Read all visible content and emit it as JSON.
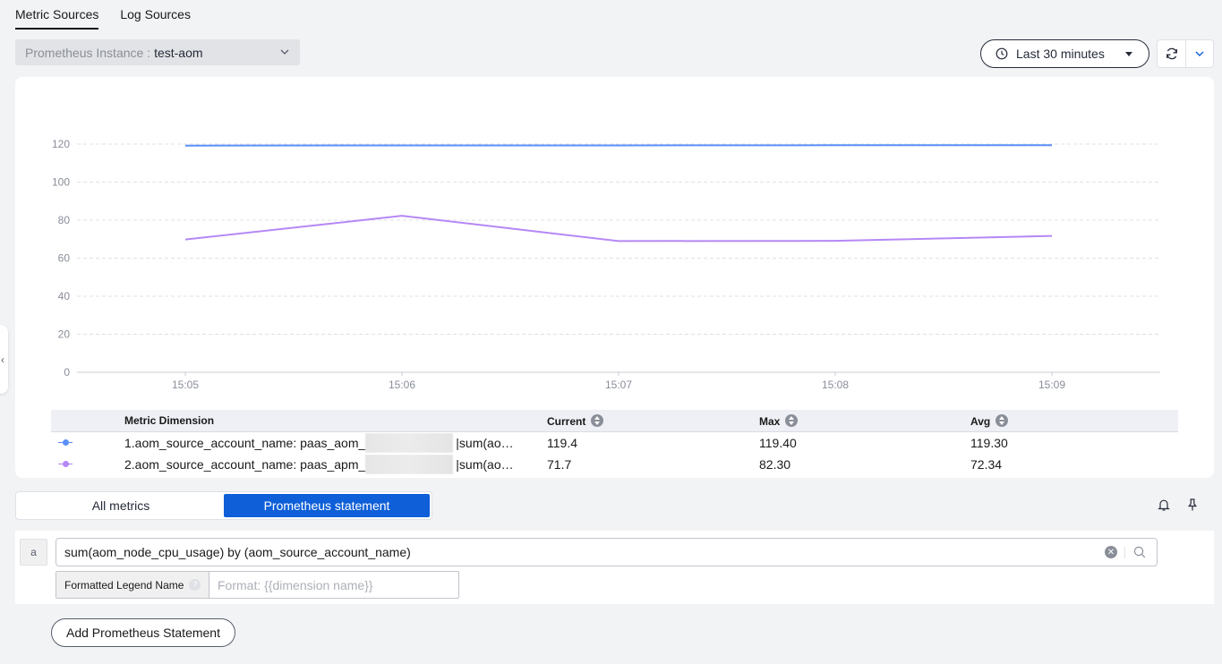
{
  "tabs": [
    {
      "label": "Metric Sources",
      "active": true
    },
    {
      "label": "Log Sources",
      "active": false
    }
  ],
  "instance": {
    "label": "Prometheus Instance :",
    "value": "test-aom"
  },
  "time_range": {
    "label": "Last 30 minutes"
  },
  "chart_data": {
    "type": "line",
    "x": [
      "15:05",
      "15:06",
      "15:07",
      "15:08",
      "15:09"
    ],
    "ylim": [
      0,
      120
    ],
    "yticks": [
      0,
      20,
      40,
      60,
      80,
      100,
      120
    ],
    "grid": true,
    "series": [
      {
        "color": "#5b8ff9",
        "values": [
          119.2,
          119.3,
          119.3,
          119.4,
          119.4
        ]
      },
      {
        "color": "#b588f5",
        "values": [
          69.8,
          82.3,
          69.0,
          69.1,
          71.7
        ]
      }
    ]
  },
  "legend_table": {
    "headers": {
      "dimension": "Metric Dimension",
      "current": "Current",
      "max": "Max",
      "avg": "Avg"
    },
    "rows": [
      {
        "prefix": "1.aom_source_account_name: paas_aom_",
        "suffix": "|sum(aom_node_cpu_usage)",
        "current": "119.4",
        "max": "119.40",
        "avg": "119.30",
        "color": "#5b8ff9"
      },
      {
        "prefix": "2.aom_source_account_name: paas_apm_",
        "suffix": "|sum(aom_node_cpu_usage)",
        "current": "71.7",
        "max": "82.30",
        "avg": "72.34",
        "color": "#b588f5"
      }
    ]
  },
  "mode": {
    "all_metrics": "All metrics",
    "prometheus_statement": "Prometheus statement"
  },
  "query": {
    "label": "a",
    "value": "sum(aom_node_cpu_usage) by (aom_source_account_name)",
    "legend_label": "Formatted Legend Name",
    "legend_placeholder": "Format: {{dimension name}}"
  },
  "add_button": "Add Prometheus Statement"
}
